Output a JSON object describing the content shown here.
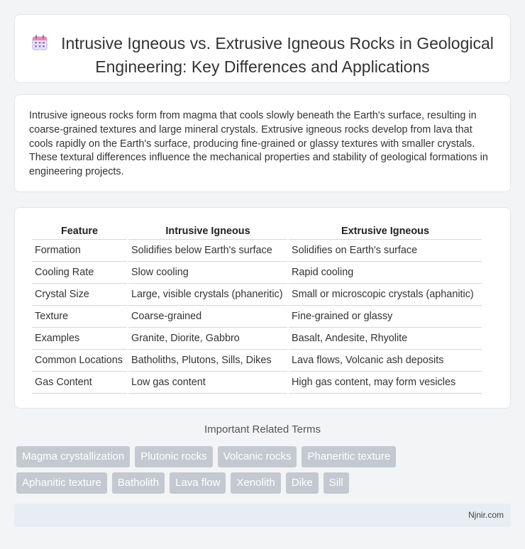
{
  "header": {
    "icon": "calendar-icon",
    "title": "Intrusive Igneous vs. Extrusive Igneous Rocks in Geological Engineering: Key Differences and Applications"
  },
  "intro": "Intrusive igneous rocks form from magma that cools slowly beneath the Earth's surface, resulting in coarse-grained textures and large mineral crystals. Extrusive igneous rocks develop from lava that cools rapidly on the Earth's surface, producing fine-grained or glassy textures with smaller crystals. These textural differences influence the mechanical properties and stability of geological formations in engineering projects.",
  "table": {
    "headers": [
      "Feature",
      "Intrusive Igneous",
      "Extrusive Igneous"
    ],
    "rows": [
      [
        "Formation",
        "Solidifies below Earth's surface",
        "Solidifies on Earth's surface"
      ],
      [
        "Cooling Rate",
        "Slow cooling",
        "Rapid cooling"
      ],
      [
        "Crystal Size",
        "Large, visible crystals (phaneritic)",
        "Small or microscopic crystals (aphanitic)"
      ],
      [
        "Texture",
        "Coarse-grained",
        "Fine-grained or glassy"
      ],
      [
        "Examples",
        "Granite, Diorite, Gabbro",
        "Basalt, Andesite, Rhyolite"
      ],
      [
        "Common Locations",
        "Batholiths, Plutons, Sills, Dikes",
        "Lava flows, Volcanic ash deposits"
      ],
      [
        "Gas Content",
        "Low gas content",
        "High gas content, may form vesicles"
      ]
    ]
  },
  "related": {
    "title": "Important Related Terms",
    "tags_row1": [
      "Magma crystallization",
      "Plutonic rocks",
      "Volcanic rocks",
      "Phaneritic texture"
    ],
    "tags_row2": [
      "Aphanitic texture",
      "Batholith",
      "Lava flow",
      "Xenolith",
      "Dike",
      "Sill"
    ]
  },
  "footer": {
    "brand": "Njnir.com"
  }
}
